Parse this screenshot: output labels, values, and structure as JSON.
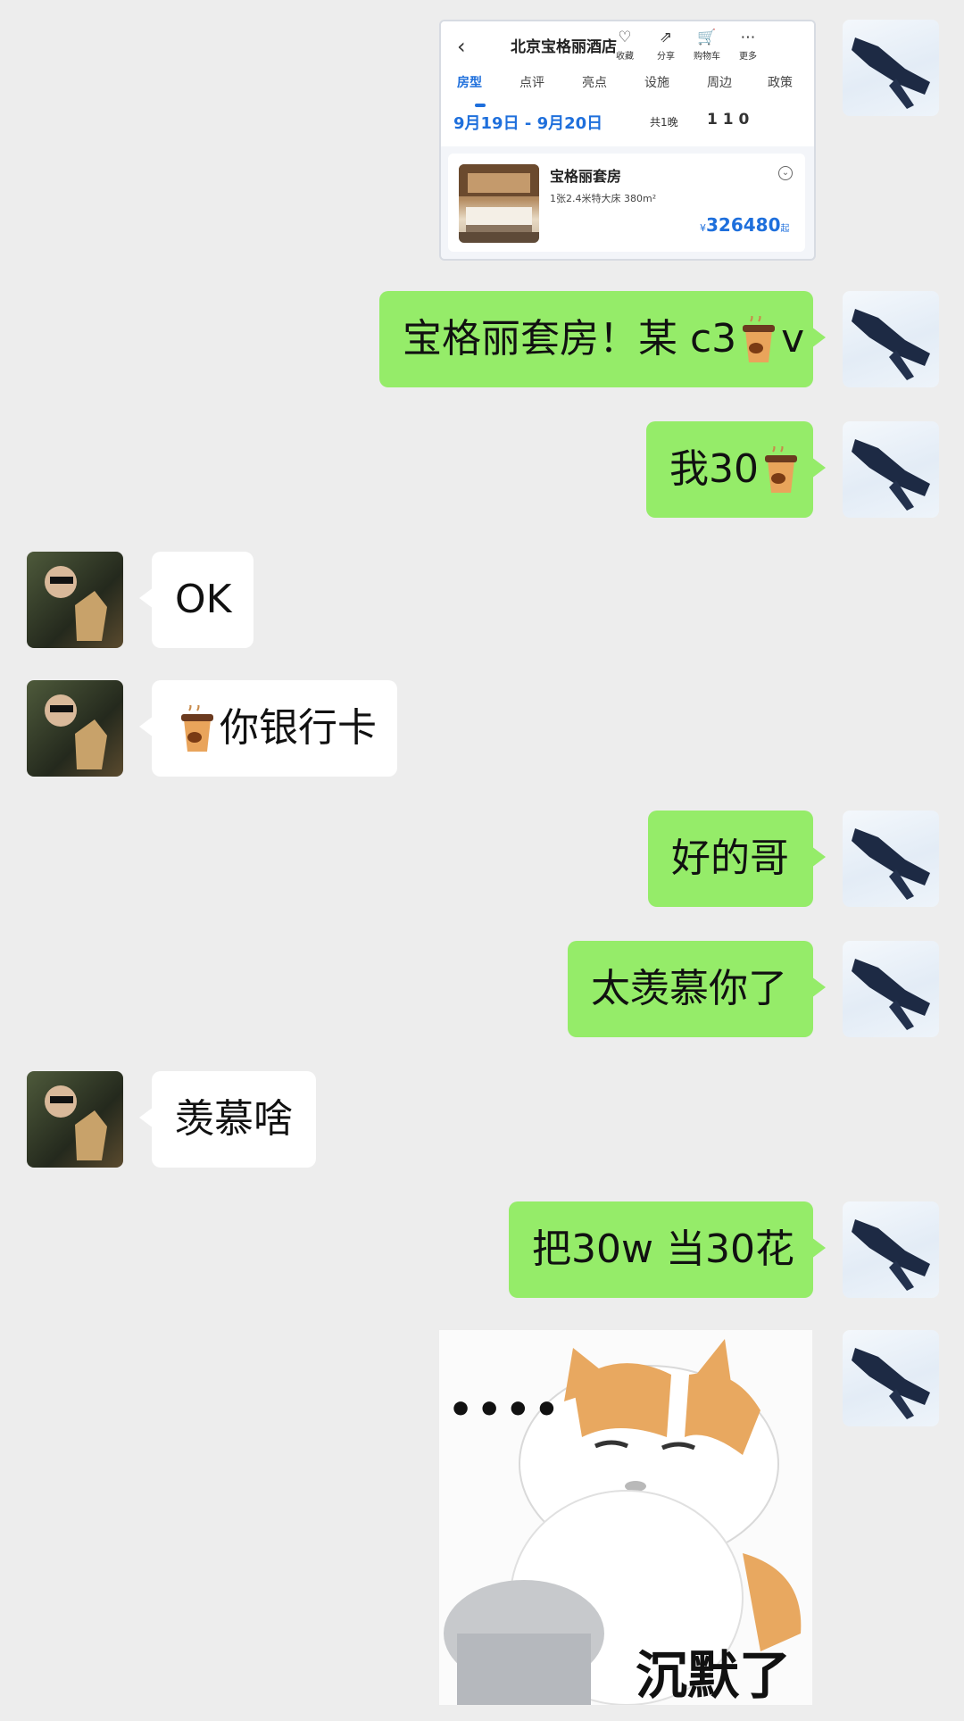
{
  "hotel_card": {
    "title": "北京宝格丽酒店",
    "actions": [
      {
        "label": "收藏",
        "icon": "heart-icon"
      },
      {
        "label": "分享",
        "icon": "share-icon"
      },
      {
        "label": "购物车",
        "icon": "cart-icon"
      },
      {
        "label": "更多",
        "icon": "more-icon"
      }
    ],
    "tabs": [
      "房型",
      "点评",
      "亮点",
      "设施",
      "周边",
      "政策"
    ],
    "dates": "9月19日 - 9月20日",
    "nights": "共1晚",
    "guests": "1 1 0",
    "room": {
      "name": "宝格丽套房",
      "desc": "1张2.4米特大床  380m²",
      "currency": "¥",
      "price": "326480",
      "price_suffix": "起"
    }
  },
  "messages": [
    {
      "side": "me",
      "before": "宝格丽套房！某 c3",
      "after": "v",
      "emoji": "coffee-cup"
    },
    {
      "side": "me",
      "before": "我30",
      "after": "",
      "emoji": "coffee-cup"
    },
    {
      "side": "other",
      "text": "OK"
    },
    {
      "side": "other",
      "before": "",
      "after": "你银行卡",
      "emoji": "coffee-cup"
    },
    {
      "side": "me",
      "text": "好的哥"
    },
    {
      "side": "me",
      "text": "太羡慕你了"
    },
    {
      "side": "other",
      "text": "羡慕啥"
    },
    {
      "side": "me",
      "text": "把30w 当30花"
    }
  ],
  "sticker": {
    "dots": "••••",
    "caption": "沉默了",
    "icon": "cat-sticker"
  },
  "colors": {
    "background": "#ededed",
    "my_bubble": "#95ec69",
    "other_bubble": "#ffffff",
    "accent_blue": "#1e6fdc"
  }
}
